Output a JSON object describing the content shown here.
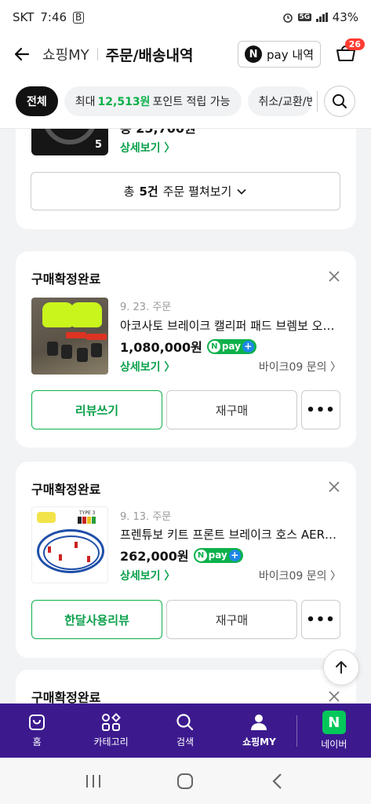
{
  "status_bar": {
    "carrier": "SKT",
    "time": "7:46",
    "b_icon": "B",
    "network": "5G",
    "battery": "43%"
  },
  "header": {
    "brand": "쇼핑MY",
    "title": "주문/배송내역",
    "npay_label": "pay 내역",
    "npay_n": "N",
    "cart_count": "26"
  },
  "filters": {
    "all": "전체",
    "points_prefix": "최대",
    "points_value": "12,513원",
    "points_suffix": "포인트 적립 가능",
    "cancel": "취소/교환/반품"
  },
  "card1": {
    "thumb_count": "5",
    "price_clipped": "총 25,700원",
    "detail_link": "상세보기 〉",
    "expand_prefix": "총",
    "expand_count": "5건",
    "expand_suffix": "주문 펼쳐보기"
  },
  "orders": [
    {
      "status": "구매확정완료",
      "date": "9. 23. 주문",
      "name": "아코사토 브레이크 캘리퍼 패드 브렘보 오토바이 브레이크",
      "price": "1,080,000원",
      "detail_link": "상세보기 〉",
      "seller": "바이크09 문의 〉",
      "primary_button": "리뷰쓰기",
      "secondary_button": "재구매",
      "more_button": "•••"
    },
    {
      "status": "구매확정완료",
      "date": "9. 13. 주문",
      "name": "프렌튜보 키트 프론트 브레이크 호스 AEROQUIP",
      "price": "262,000원",
      "detail_link": "상세보기 〉",
      "seller": "바이크09 문의 〉",
      "primary_button": "한달사용리뷰",
      "secondary_button": "재구매",
      "more_button": "•••"
    },
    {
      "status": "구매확정완료"
    }
  ],
  "npay_badge": {
    "n": "N",
    "label": "pay",
    "plus": "+"
  },
  "image_text": {
    "hose_type": "TYPE 3"
  },
  "bottom_nav": [
    {
      "label": "홈",
      "icon": "shopping-bag-icon"
    },
    {
      "label": "카테고리",
      "icon": "category-grid-icon"
    },
    {
      "label": "검색",
      "icon": "search-icon"
    },
    {
      "label": "쇼핑MY",
      "icon": "person-icon"
    },
    {
      "label": "네이버",
      "icon": "naver-n-icon",
      "glyph": "N"
    }
  ],
  "colors": {
    "accent_green": "#0db14b",
    "nav_purple": "#3c1a8e",
    "badge_red": "#ff3b30",
    "naver_green": "#03c75a"
  }
}
